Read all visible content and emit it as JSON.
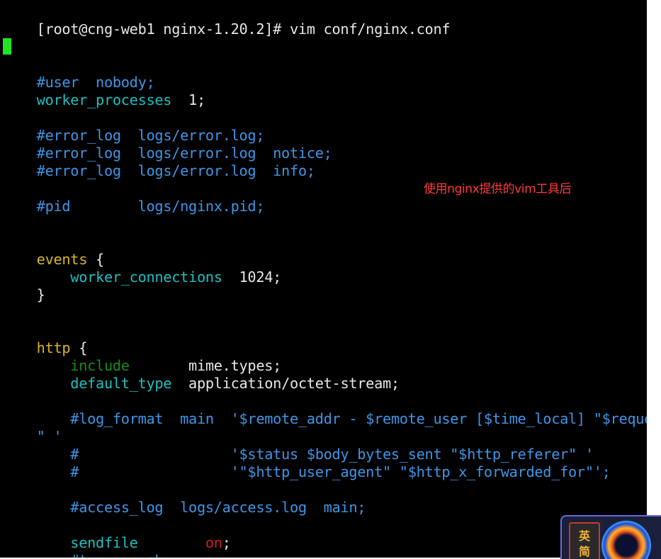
{
  "terminal": {
    "prompt_line": "[root@cng-web1 nginx-1.20.2]# vim conf/nginx.conf",
    "lines": {
      "user_comment": "#user  nobody;",
      "worker_processes_key": "worker_processes",
      "worker_processes_val": "  1;",
      "error_log_1_key": "#error_log",
      "error_log_1_val": "  logs/error.log;",
      "error_log_2_key": "#error_log",
      "error_log_2_val": "  logs/error.log  notice;",
      "error_log_3_key": "#error_log",
      "error_log_3_val": "  logs/error.log  info;",
      "pid_comment": "#pid        logs/nginx.pid;",
      "events_key": "events",
      "events_brace": " {",
      "worker_connections_key": "    worker_connections",
      "worker_connections_val": "  1024;",
      "close_brace": "}",
      "http_key": "http",
      "http_brace": " {",
      "include_key": "    include",
      "include_val": "       mime.types;",
      "default_type_key": "    default_type",
      "default_type_val": "  application/octet-stream;",
      "log_format_line1": "    #log_format  main  '$remote_addr - $remote_user [$time_local] \"$request",
      "log_format_line2": "\" '",
      "log_format_line3": "    #                  '$status $body_bytes_sent \"$http_referer\" '",
      "log_format_line4": "    #                  '\"$http_user_agent\" \"$http_x_forwarded_for\"';",
      "access_log_comment": "    #access_log  logs/access.log  main;",
      "sendfile_key": "    sendfile",
      "sendfile_on": "        on",
      "sendfile_semicolon": ";",
      "tcp_nopush_comment": "    #tcp_nopush     on;"
    }
  },
  "annotation": "使用nginx提供的vim工具后",
  "ime": {
    "char1": "英",
    "char2": "简"
  },
  "colors": {
    "background": "#000000",
    "comment": "#3f95e6",
    "directive": "#1dbfbf",
    "keyword": "#d7b52a",
    "include": "#1a8a1a",
    "on": "#d01a1a",
    "cursor": "#22e622",
    "annotation": "#ff3b3b"
  }
}
